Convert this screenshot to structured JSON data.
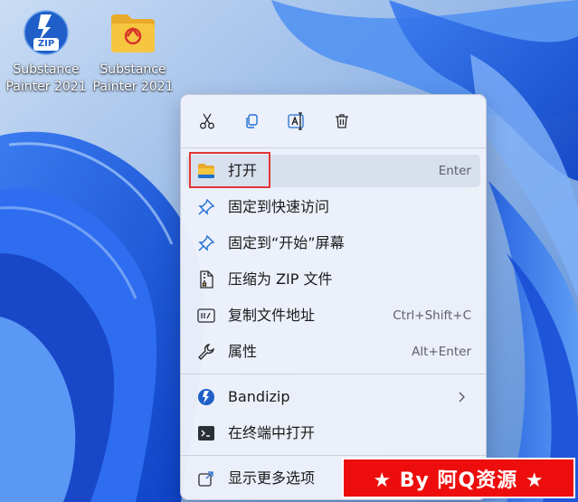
{
  "desktop": {
    "icons": [
      {
        "line1": "Substance",
        "line2": "Painter 2021",
        "icon": "zip-archive-icon",
        "badge": "ZIP"
      },
      {
        "line1": "Substance",
        "line2": "Painter 2021",
        "icon": "folder-icon"
      }
    ]
  },
  "context_menu": {
    "toolbar": [
      "cut-icon",
      "copy-icon",
      "rename-icon",
      "delete-icon"
    ],
    "items": [
      {
        "label": "打开",
        "accelerator": "Enter",
        "icon": "folder-open-icon"
      },
      {
        "label": "固定到快速访问",
        "icon": "pin-icon"
      },
      {
        "label": "固定到“开始”屏幕",
        "icon": "pin-icon"
      },
      {
        "label": "压缩为 ZIP 文件",
        "icon": "zip-file-icon"
      },
      {
        "label": "复制文件地址",
        "accelerator": "Ctrl+Shift+C",
        "icon": "copy-path-icon"
      },
      {
        "label": "属性",
        "accelerator": "Alt+Enter",
        "icon": "wrench-icon"
      },
      {
        "label": "Bandizip",
        "icon": "bandizip-icon",
        "has_submenu": true
      },
      {
        "label": "在终端中打开",
        "icon": "terminal-icon"
      },
      {
        "label": "显示更多选项",
        "icon": "more-options-icon"
      }
    ]
  },
  "watermark": {
    "text": "★ By 阿Q资源 ★"
  },
  "colors": {
    "accent": "#1f6fd1",
    "highlight_border": "#e23636",
    "banner": "#ee0d0d",
    "folder": "#f6c640"
  }
}
